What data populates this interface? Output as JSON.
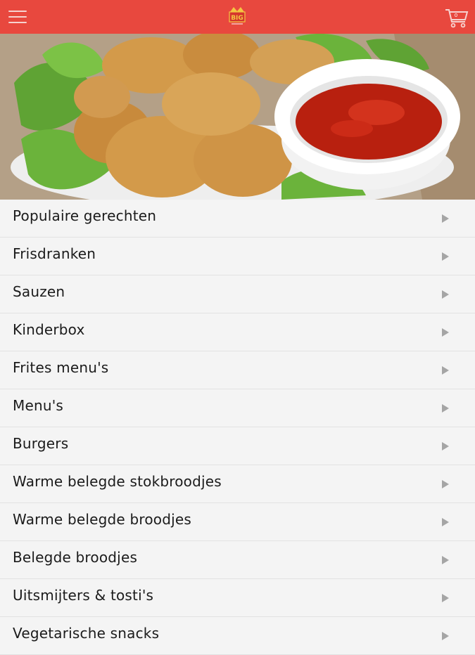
{
  "header": {
    "brand_color": "#e8483e",
    "logo_text": "BIG",
    "cart_count": "0",
    "icons": [
      "hamburger-menu-icon",
      "logo-icon",
      "shopping-cart-icon"
    ]
  },
  "hero": {
    "image": "chicken nuggets with ketchup"
  },
  "categories": [
    {
      "label": "Populaire gerechten"
    },
    {
      "label": "Frisdranken"
    },
    {
      "label": "Sauzen"
    },
    {
      "label": "Kinderbox"
    },
    {
      "label": "Frites menu's"
    },
    {
      "label": "Menu's"
    },
    {
      "label": "Burgers"
    },
    {
      "label": "Warme belegde stokbroodjes"
    },
    {
      "label": "Warme belegde broodjes"
    },
    {
      "label": "Belegde broodjes"
    },
    {
      "label": "Uitsmijters & tosti's"
    },
    {
      "label": "Vegetarische snacks"
    }
  ]
}
